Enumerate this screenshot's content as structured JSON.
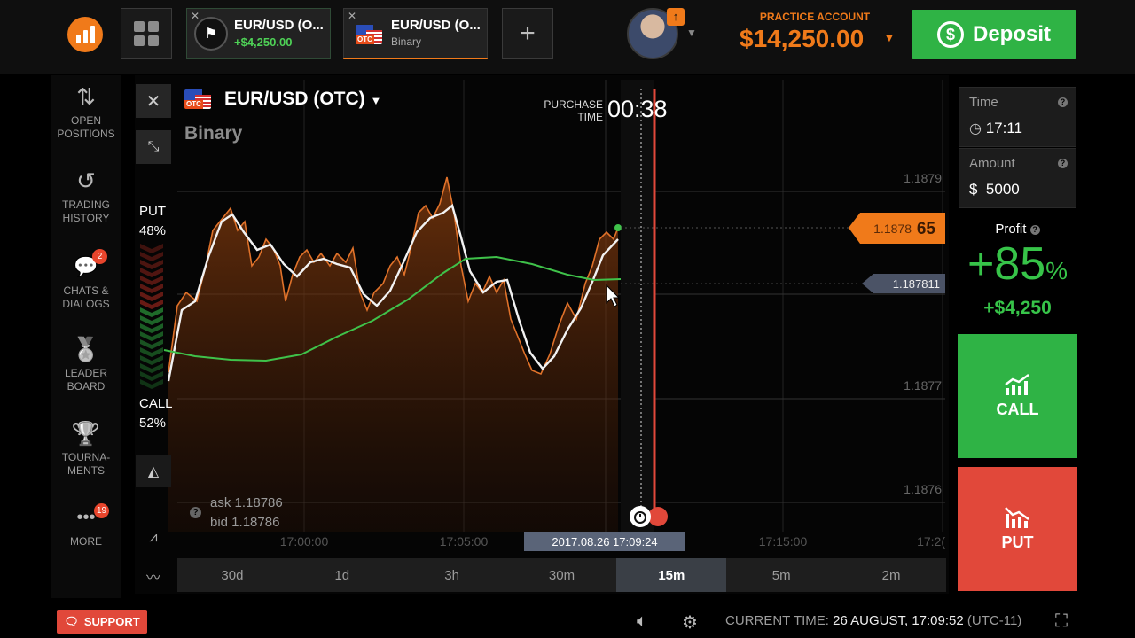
{
  "header": {
    "tabs": [
      {
        "title": "EUR/USD (O...",
        "subtitle": "+$4,250.00"
      },
      {
        "title": "EUR/USD (O...",
        "subtitle": "Binary"
      }
    ],
    "account_label": "PRACTICE ACCOUNT",
    "balance": "$14,250.00",
    "deposit_label": "Deposit",
    "avatar_badge": "↑"
  },
  "sidebar": {
    "items": [
      {
        "label_1": "OPEN",
        "label_2": "POSITIONS",
        "icon": "⇅",
        "badge": ""
      },
      {
        "label_1": "TRADING",
        "label_2": "HISTORY",
        "icon": "↺",
        "badge": ""
      },
      {
        "label_1": "CHATS &",
        "label_2": "DIALOGS",
        "icon": "💬",
        "badge": "2"
      },
      {
        "label_1": "LEADER",
        "label_2": "BOARD",
        "icon": "🏅",
        "badge": ""
      },
      {
        "label_1": "TOURNA-",
        "label_2": "MENTS",
        "icon": "🏆",
        "badge": ""
      },
      {
        "label_1": "MORE",
        "label_2": "",
        "icon": "•••",
        "badge": "19"
      }
    ]
  },
  "chart": {
    "asset": "EUR/USD (OTC)",
    "type": "Binary",
    "purchase_label_1": "PURCHASE",
    "purchase_label_2": "TIME",
    "purchase_countdown": "00:38",
    "put_label": "PUT",
    "put_pct": "48%",
    "call_label": "CALL",
    "call_pct": "52%",
    "ask": "ask 1.18786",
    "bid": "bid 1.18786",
    "price_levels": [
      "1.1879",
      "1.1877",
      "1.1876"
    ],
    "current_price_main": "1.1878",
    "current_price_tail": "65",
    "strike_price": "1.187811",
    "time_ticks": [
      "17:00:00",
      "17:05:00",
      "17:15:00",
      "17:2("
    ],
    "cursor_time": "2017.08.26 17:09:24",
    "timeframes": [
      "30d",
      "1d",
      "3h",
      "30m",
      "15m",
      "5m",
      "2m"
    ],
    "active_timeframe": "15m"
  },
  "panel": {
    "time_label": "Time",
    "time_value": "17:11",
    "amount_label": "Amount",
    "amount_currency": "$",
    "amount_value": "5000",
    "profit_label": "Profit",
    "profit_pct": "+85",
    "profit_pct_sign": "%",
    "profit_amount": "+$4,250",
    "call_label": "CALL",
    "put_label": "PUT"
  },
  "footer": {
    "support_label": "SUPPORT",
    "current_time_label": "CURRENT TIME:",
    "current_time_value": "26 AUGUST, 17:09:52",
    "timezone": "(UTC-11)"
  },
  "colors": {
    "brand_orange": "#f07a1a",
    "call_green": "#2fb345",
    "put_red": "#e1483a",
    "ma_green": "#3fc24a"
  }
}
